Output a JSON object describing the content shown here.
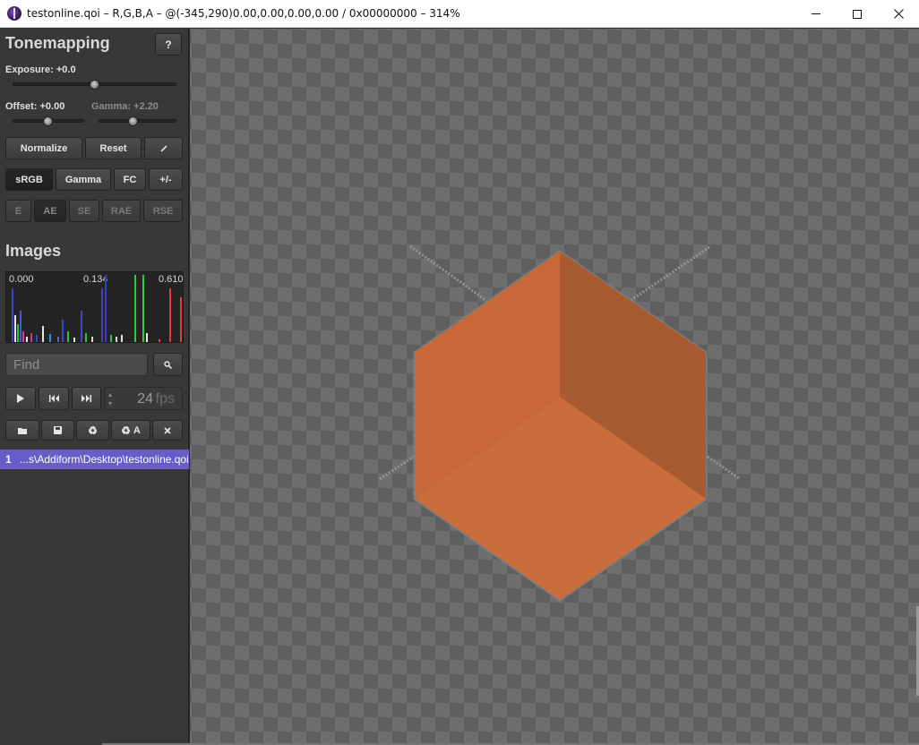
{
  "window": {
    "title": "testonline.qoi – R,G,B,A – @(-345,290)0.00,0.00,0.00,0.00 / 0x00000000 – 314%"
  },
  "tonemapping": {
    "title": "Tonemapping",
    "help_label": "?",
    "exposure_label": "Exposure: +0.0",
    "offset_label": "Offset: +0.00",
    "gamma_label": "Gamma: +2.20",
    "exposure_value": 0.0,
    "offset_value": 0.0,
    "gamma_value": 2.2,
    "normalize_label": "Normalize",
    "reset_label": "Reset",
    "pick_icon": "pencil-icon",
    "modes": [
      "sRGB",
      "Gamma",
      "FC",
      "+/-"
    ],
    "active_mode": "sRGB",
    "metrics": [
      "E",
      "AE",
      "SE",
      "RAE",
      "RSE"
    ],
    "active_metric": "AE"
  },
  "images": {
    "title": "Images",
    "histogram": {
      "min_label": "0.000",
      "mid_label": "0.134",
      "max_label": "0.610"
    },
    "find_placeholder": "Find",
    "search_icon": "search-icon",
    "playback": {
      "play_icon": "play-icon",
      "prev_icon": "skip-back-icon",
      "next_icon": "skip-forward-icon",
      "fps_value": "24",
      "fps_unit": "fps"
    },
    "file_actions": {
      "open_icon": "folder-icon",
      "save_icon": "save-icon",
      "reload_icon": "recycle-icon",
      "reload_all_label": "A",
      "close_icon": "close-icon"
    },
    "list": [
      {
        "index": "1",
        "path": "...s\\Addiform\\Desktop\\testonline.qoi"
      }
    ]
  },
  "colors": {
    "accent": "#6a5cc6",
    "cube_left": "#c86738",
    "cube_right": "#a85a30",
    "cube_bottom": "#ca6d3c"
  }
}
